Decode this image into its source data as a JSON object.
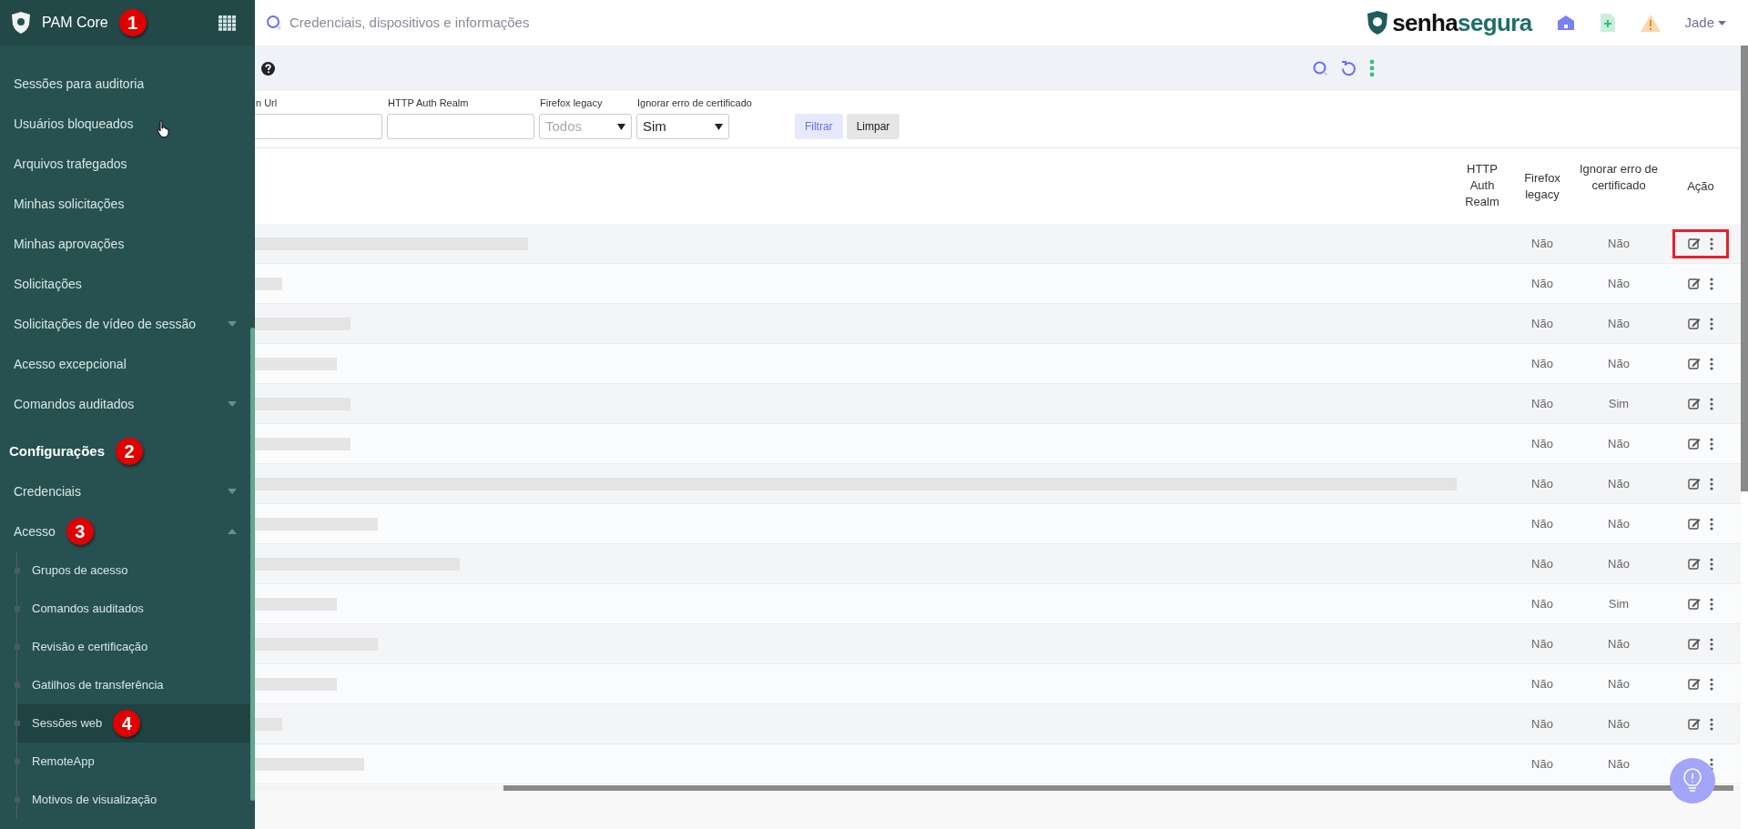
{
  "sidebar": {
    "app_title": "PAM Core",
    "badge": "1",
    "items": [
      {
        "label": "Sessões para auditoria",
        "has_caret": false
      },
      {
        "label": "Usuários bloqueados",
        "has_caret": false,
        "hovered": true
      },
      {
        "label": "Arquivos trafegados",
        "has_caret": false
      },
      {
        "label": "Minhas solicitações",
        "has_caret": false
      },
      {
        "label": "Minhas aprovações",
        "has_caret": false
      },
      {
        "label": "Solicitações",
        "has_caret": false
      },
      {
        "label": "Solicitações de vídeo de sessão",
        "has_caret": true
      },
      {
        "label": "Acesso excepcional",
        "has_caret": false
      },
      {
        "label": "Comandos auditados",
        "has_caret": true
      }
    ],
    "section": {
      "title": "Configurações",
      "badge": "2"
    },
    "section_items": [
      {
        "label": "Credenciais",
        "expanded": false
      },
      {
        "label": "Acesso",
        "expanded": true,
        "badge": "3",
        "children": [
          {
            "label": "Grupos de acesso",
            "selected": false
          },
          {
            "label": "Comandos auditados",
            "selected": false
          },
          {
            "label": "Revisão e certificação",
            "selected": false
          },
          {
            "label": "Gatilhos de transferência",
            "selected": false
          },
          {
            "label": "Sessões web",
            "selected": true,
            "badge": "4"
          },
          {
            "label": "RemoteApp",
            "selected": false
          },
          {
            "label": "Motivos de visualização",
            "selected": false
          }
        ]
      }
    ]
  },
  "header": {
    "search_placeholder": "Credenciais, dispositivos e informações",
    "logo": [
      "senha",
      "segura"
    ],
    "user": "Jade"
  },
  "filters": [
    {
      "kind": "input",
      "label": "n Url"
    },
    {
      "kind": "input",
      "label": "HTTP Auth Realm"
    },
    {
      "kind": "select",
      "label": "Firefox legacy",
      "value": "Todos",
      "placeholder_style": true
    },
    {
      "kind": "select",
      "label": "Ignorar erro de certificado",
      "value": "Sim",
      "placeholder_style": false
    }
  ],
  "filter_buttons": [
    {
      "label": "Filtrar",
      "kind": "primary"
    },
    {
      "label": "Limpar",
      "kind": "secondary"
    }
  ],
  "table": {
    "columns": [
      "HTTP Auth Realm",
      "Firefox legacy",
      "Ignorar erro de certificado",
      "Ação"
    ],
    "rows": [
      {
        "firefox_legacy": "Não",
        "ignore_cert": "Não",
        "highlighted": true
      },
      {
        "firefox_legacy": "Não",
        "ignore_cert": "Não",
        "highlighted": false
      },
      {
        "firefox_legacy": "Não",
        "ignore_cert": "Não",
        "highlighted": false
      },
      {
        "firefox_legacy": "Não",
        "ignore_cert": "Não",
        "highlighted": false
      },
      {
        "firefox_legacy": "Não",
        "ignore_cert": "Sim",
        "highlighted": false
      },
      {
        "firefox_legacy": "Não",
        "ignore_cert": "Não",
        "highlighted": false
      },
      {
        "firefox_legacy": "Não",
        "ignore_cert": "Não",
        "highlighted": false
      },
      {
        "firefox_legacy": "Não",
        "ignore_cert": "Não",
        "highlighted": false
      },
      {
        "firefox_legacy": "Não",
        "ignore_cert": "Não",
        "highlighted": false
      },
      {
        "firefox_legacy": "Não",
        "ignore_cert": "Sim",
        "highlighted": false
      },
      {
        "firefox_legacy": "Não",
        "ignore_cert": "Não",
        "highlighted": false
      },
      {
        "firefox_legacy": "Não",
        "ignore_cert": "Não",
        "highlighted": false
      },
      {
        "firefox_legacy": "Não",
        "ignore_cert": "Não",
        "highlighted": false
      },
      {
        "firefox_legacy": "Não",
        "ignore_cert": "Não",
        "highlighted": false
      }
    ]
  }
}
